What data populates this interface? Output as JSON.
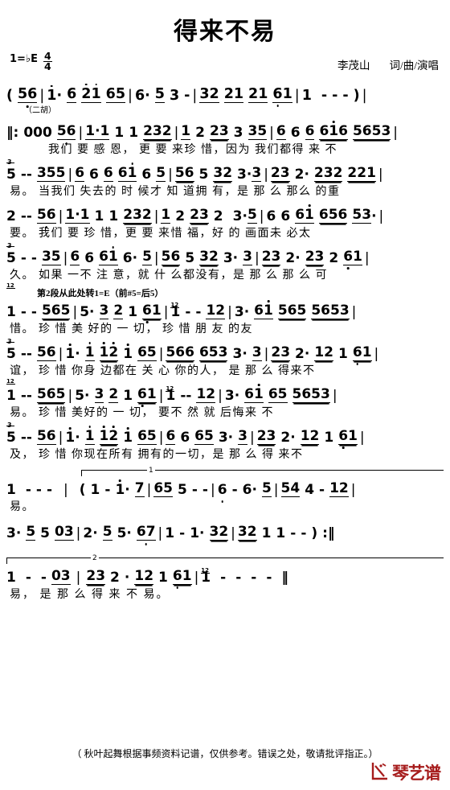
{
  "header": {
    "title": "得来不易",
    "key_prefix": "1=",
    "key_accidental": "♭",
    "key_note": "E",
    "time_numerator": "4",
    "time_denominator": "4",
    "composer": "李茂山",
    "roles": "词/曲/演唱"
  },
  "intro_label": "（二胡）",
  "annotation": "第2段从此处转1=E（前#5=后5）",
  "systems": [
    {
      "id": "system-1",
      "notes": "( 56 | 1· 6 21 65 | 6· 5 3 - | 32 21 21 61 | 1 - - - ) |",
      "lyrics": ""
    },
    {
      "id": "system-2",
      "notes": "‖: 000 56 | 1·1 1 1 232 | 1 2 23 3 35 | 6 6 6 616 5653 |",
      "lyrics": "我们 要 感 恩， 更 要 来珍 惜，因为 我们都得 来 不"
    },
    {
      "id": "system-3",
      "notes": "5 - - 355 | 6 6 6 61 6 5 | 56 5 32 3·3 | 23 2· 232 221 |",
      "lyrics": "易。 当我们 失去的 时 候才 知 道拥 有，是 那 么 那么 的重"
    },
    {
      "id": "system-4",
      "notes": "2 - - 56 | 1·1 1 1 232 | 1 2 23 2 3·5 | 6 6 61 656 53· |",
      "lyrics": "要。 我们 要 珍 惜，更 要 来惜 福，好 的 画面未 必太"
    },
    {
      "id": "system-5",
      "notes": "5 - - 35 | 6 6 61 6· 5 | 56 5 32 3· 3 | 23 2· 23 2 61 |",
      "lyrics": "久。 如果 一不 注 意，就 什 么都没有，是 那 么 那 么 可"
    },
    {
      "id": "system-6",
      "notes": "1 - - 565 | 5· 3 2 1 61 | 1 - - 12 | 3· 61 565 5653 |",
      "lyrics": "惜。 珍 惜 美 好的 一 切， 珍 惜 朋 友 的友"
    },
    {
      "id": "system-7",
      "notes": "5 - - 56 | 1· 1 12 1 65 | 566 653 3· 3 | 23 2· 12 1 61 |",
      "lyrics": "谊， 珍 惜 你身 边都在 关 心 你的人， 是 那 么 得来不"
    },
    {
      "id": "system-8",
      "notes": "1 - - 565 | 5· 3 2 1 61 | 1 - - 12 | 3· 61 65 5653 |",
      "lyrics": "易。 珍 惜 美好的 一 切， 要不 然 就 后悔来 不"
    },
    {
      "id": "system-9",
      "notes": "5 - - 56 | 1· 1 12 1 65 | 6 6 65 3· 3 | 23 2· 12 1 61 |",
      "lyrics": "及， 珍 惜 你现在所有 拥有的一切，是 那 么 得 来不"
    },
    {
      "id": "system-10",
      "notes": "1 - - - | ( 1 - 1· 7 | 65 5 - - | 6 - 6· 5 | 54 4 - 12 |",
      "lyrics": "易。",
      "volta": "1"
    },
    {
      "id": "system-11",
      "notes": "3· 5 5 03 | 2· 5 5· 67 | 1 - 1· 32 | 32 1 1 - - ) :‖",
      "lyrics": ""
    },
    {
      "id": "system-12",
      "notes": "1 - - 03 | 23 2 · 12 1 61 | 1 - - - - ‖",
      "lyrics": "易， 是 那 么 得 来 不 易。",
      "volta": "2"
    }
  ],
  "footer": {
    "note": "（ 秋叶起舞根据事频资料记谱，仅供参考。错误之处，敬请批评指正。）",
    "logo_text": "琴艺谱",
    "logo_color": "#a61c1c"
  }
}
